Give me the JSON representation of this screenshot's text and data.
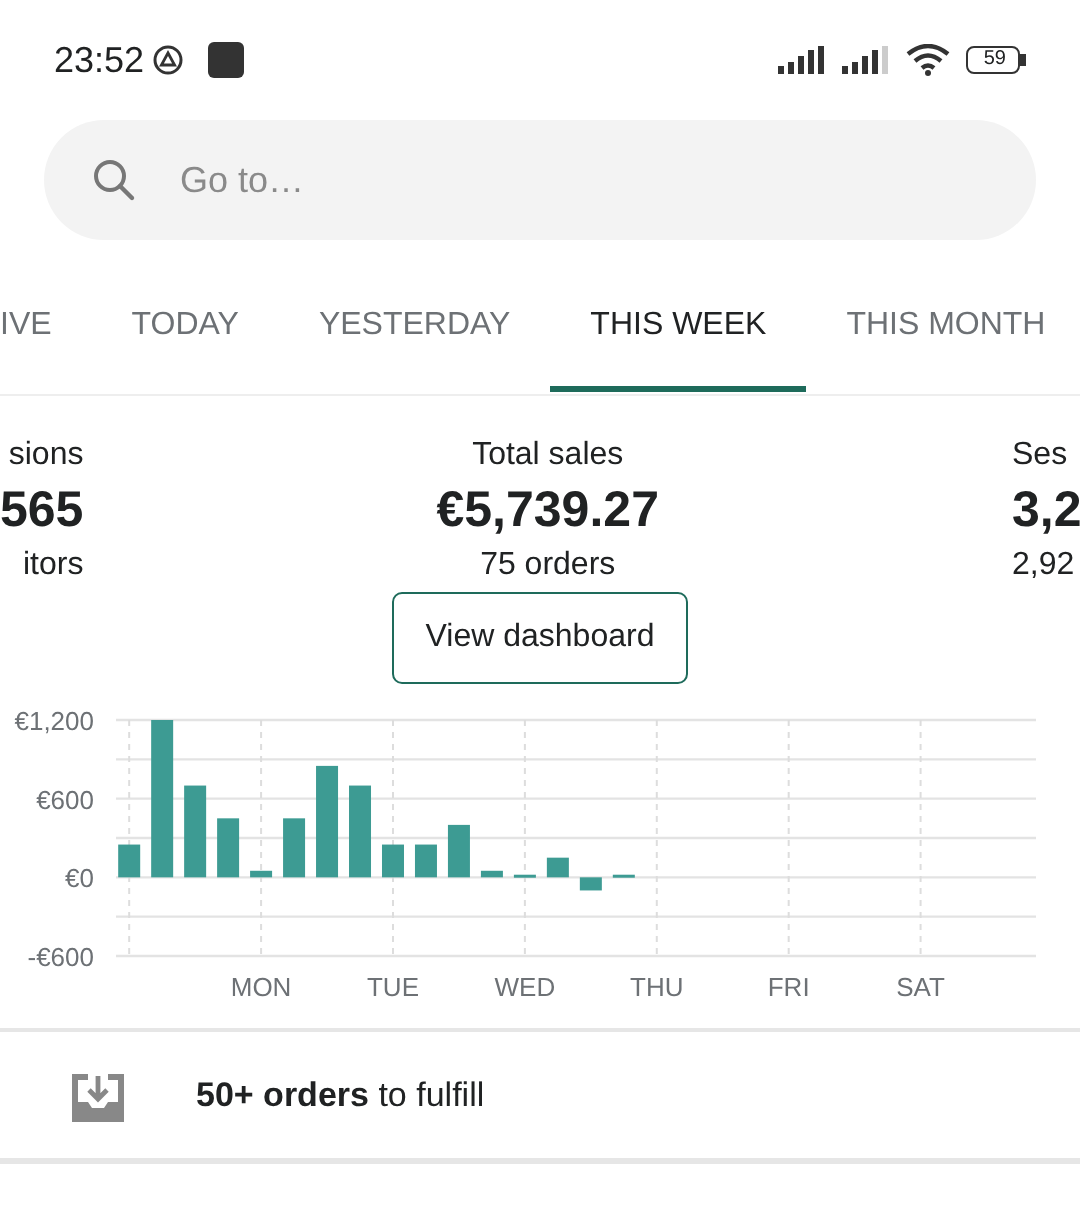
{
  "status_bar": {
    "time": "23:52",
    "battery": "59"
  },
  "search": {
    "placeholder": "Go to…"
  },
  "tabs": [
    {
      "label": "IVE",
      "selected": false
    },
    {
      "label": "TODAY",
      "selected": false
    },
    {
      "label": "YESTERDAY",
      "selected": false
    },
    {
      "label": "THIS WEEK",
      "selected": true
    },
    {
      "label": "THIS MONTH",
      "selected": false
    }
  ],
  "metrics": [
    {
      "title": "sions",
      "value": "565",
      "detail": "itors"
    },
    {
      "title": "Total sales",
      "value": "€5,739.27",
      "detail": "75 orders"
    },
    {
      "title": "Ses",
      "value": "3,2",
      "detail": "2,92"
    }
  ],
  "dashboard_button": "View dashboard",
  "chart_data": {
    "type": "bar",
    "categories": [
      null,
      null,
      null,
      null,
      "MON",
      null,
      null,
      null,
      "TUE",
      null,
      null,
      null,
      "WED",
      null,
      null,
      null,
      "THU",
      null,
      null,
      null,
      "FRI",
      null,
      null,
      null,
      "SAT",
      null,
      null,
      null
    ],
    "series": [
      {
        "color": "#3d9b93",
        "values": [
          250,
          1200,
          700,
          450,
          50,
          450,
          850,
          700,
          250,
          250,
          400,
          50,
          20,
          150,
          -100,
          20,
          null,
          null,
          null,
          null,
          null,
          null,
          null,
          null,
          null,
          null,
          null,
          null
        ]
      }
    ],
    "ylim": [
      -600,
      1200
    ],
    "grid": true,
    "yticks": [
      {
        "value": 1200,
        "label": "€1,200"
      },
      {
        "value": 600,
        "label": "€600"
      },
      {
        "value": 0,
        "label": "€0"
      },
      {
        "value": -600,
        "label": "-€600"
      }
    ]
  },
  "task": {
    "text": "**50+ orders** to fulfill"
  }
}
